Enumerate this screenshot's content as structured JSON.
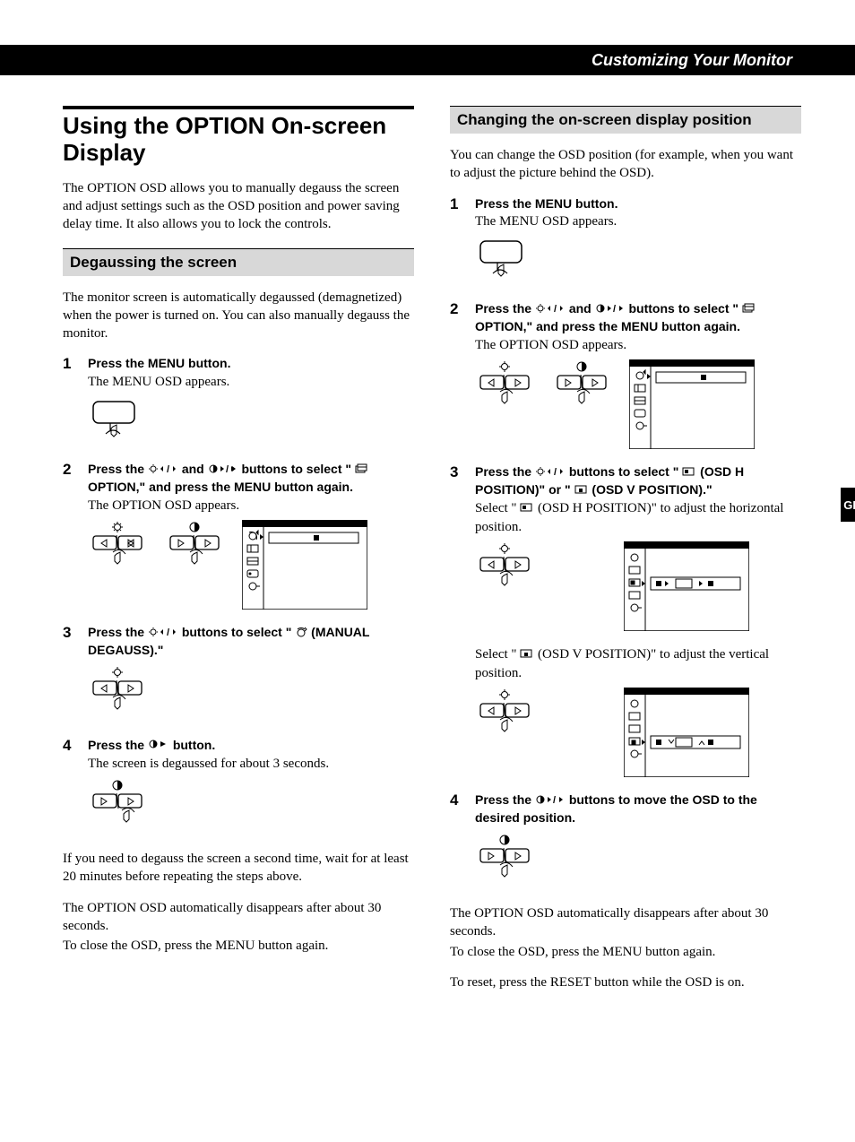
{
  "header": {
    "title": "Customizing Your Monitor"
  },
  "side_tab": "GB",
  "left": {
    "h1": "Using the OPTION On-screen Display",
    "intro": "The OPTION OSD allows you to manually degauss the screen and adjust settings such as the OSD position and power saving delay time. It also allows you to lock the controls.",
    "sub1": "Degaussing the screen",
    "p1": "The monitor screen is automatically degaussed (demagnetized) when the power is turned on. You can also manually degauss the monitor.",
    "s1_head": "Press the MENU button.",
    "s1_note": "The MENU OSD appears.",
    "s2_head_a": "Press the ",
    "s2_head_b": " and ",
    "s2_head_c": " buttons to select \" ",
    "s2_head_d": "  OPTION,\" and press the MENU button again.",
    "s2_note": "The OPTION OSD appears.",
    "s3_head_a": "Press the ",
    "s3_head_b": " buttons to select \" ",
    "s3_head_c": "  (MANUAL DEGAUSS).\"",
    "s4_head_a": "Press the ",
    "s4_head_b": " button.",
    "s4_note": "The screen is degaussed for about 3 seconds.",
    "p2": "If you need to degauss the screen a second time, wait for at least 20 minutes before repeating the steps above.",
    "p3": "The OPTION OSD automatically disappears after about 30 seconds.",
    "p4": "To close the OSD, press the MENU button again."
  },
  "right": {
    "sub1": "Changing the on-screen display position",
    "p1": "You can change the OSD position (for example, when you want to adjust the picture behind the OSD).",
    "s1_head": "Press the MENU button.",
    "s1_note": "The MENU OSD appears.",
    "s2_head_a": "Press the ",
    "s2_head_b": " and ",
    "s2_head_c": " buttons to select \" ",
    "s2_head_d": "  OPTION,\" and press the MENU button again.",
    "s2_note": "The OPTION OSD appears.",
    "s3_head_a": "Press the ",
    "s3_head_b": " buttons to select \" ",
    "s3_head_c": "  (OSD H POSITION)\" or \" ",
    "s3_head_d": "  (OSD V POSITION).\"",
    "s3_note_a": "Select \" ",
    "s3_note_b": "  (OSD H POSITION)\" to adjust the horizontal position.",
    "s3_note2_a": "Select \" ",
    "s3_note2_b": "  (OSD V POSITION)\" to adjust the vertical position.",
    "s4_head_a": "Press the ",
    "s4_head_b": " buttons to move the OSD to the desired position.",
    "p2": "The OPTION OSD automatically disappears after about 30 seconds.",
    "p3": "To close the OSD, press the MENU button again.",
    "p4": "To reset, press the RESET button while the OSD is on."
  },
  "nums": {
    "n1": "1",
    "n2": "2",
    "n3": "3",
    "n4": "4"
  }
}
